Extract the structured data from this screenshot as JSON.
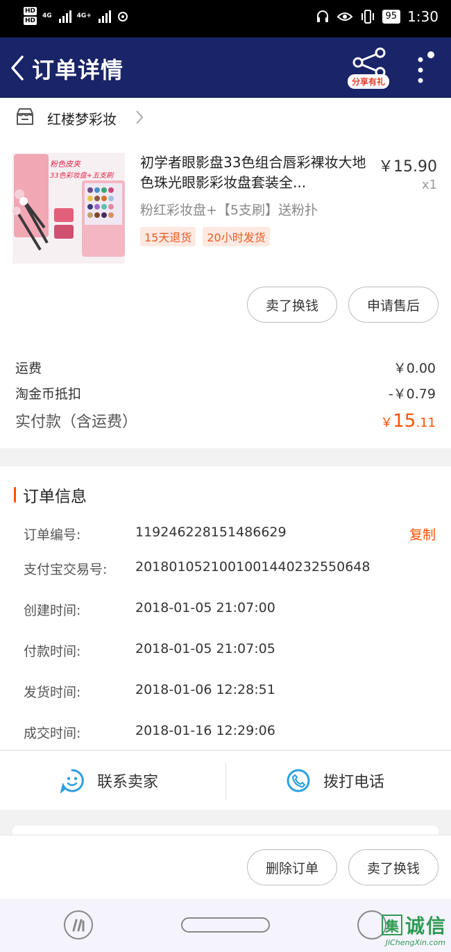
{
  "status_bar": {
    "hd1": "HD",
    "hd2": "HD",
    "net1": "4G",
    "net2": "4G+",
    "battery": "95",
    "time": "1:30"
  },
  "nav": {
    "title": "订单详情",
    "share_badge": "分享有礼",
    "bar_color": "#1a2468"
  },
  "shop": {
    "name": "红楼梦彩妆"
  },
  "item": {
    "title": "初学者眼影盘33色组合唇彩裸妆大地色珠光眼影彩妆盘套装全...",
    "price": "￥15.90",
    "quantity": "x1",
    "sku": "粉红彩妆盘+【5支刷】送粉扑",
    "tags": [
      "15天退货",
      "20小时发货"
    ],
    "thumb_text1": "粉色皮夹",
    "thumb_text2": "33色彩妆盘+五支刷",
    "buttons": {
      "resell": "卖了换钱",
      "aftersale": "申请售后"
    }
  },
  "costs": {
    "shipping_label": "运费",
    "shipping_value": "￥0.00",
    "coin_label": "淘金币抵扣",
    "coin_value": "-￥0.79",
    "paid_label": "实付款（含运费）",
    "paid_currency": "￥",
    "paid_int": "15",
    "paid_dec": ".11"
  },
  "order_info": {
    "title": "订单信息",
    "copy_label": "复制",
    "rows": [
      {
        "label": "订单编号:",
        "value": "119246228151486629"
      },
      {
        "label": "支付宝交易号:",
        "value": "2018010521001001440232550648"
      },
      {
        "label": "创建时间:",
        "value": "2018-01-05 21:07:00"
      },
      {
        "label": "付款时间:",
        "value": "2018-01-05 21:07:05"
      },
      {
        "label": "发货时间:",
        "value": "2018-01-06 12:28:51"
      },
      {
        "label": "成交时间:",
        "value": "2018-01-16 12:29:06"
      }
    ]
  },
  "contact": {
    "seller": "联系卖家",
    "call": "拨打电话"
  },
  "bottom": {
    "delete": "删除订单",
    "resell": "卖了换钱"
  },
  "watermark": {
    "box": "集",
    "text": "诚信",
    "url": "JiChengXin.com"
  },
  "colors": {
    "accent": "#ff5000",
    "nav": "#1a2468",
    "icon_blue": "#2b9fe0"
  }
}
